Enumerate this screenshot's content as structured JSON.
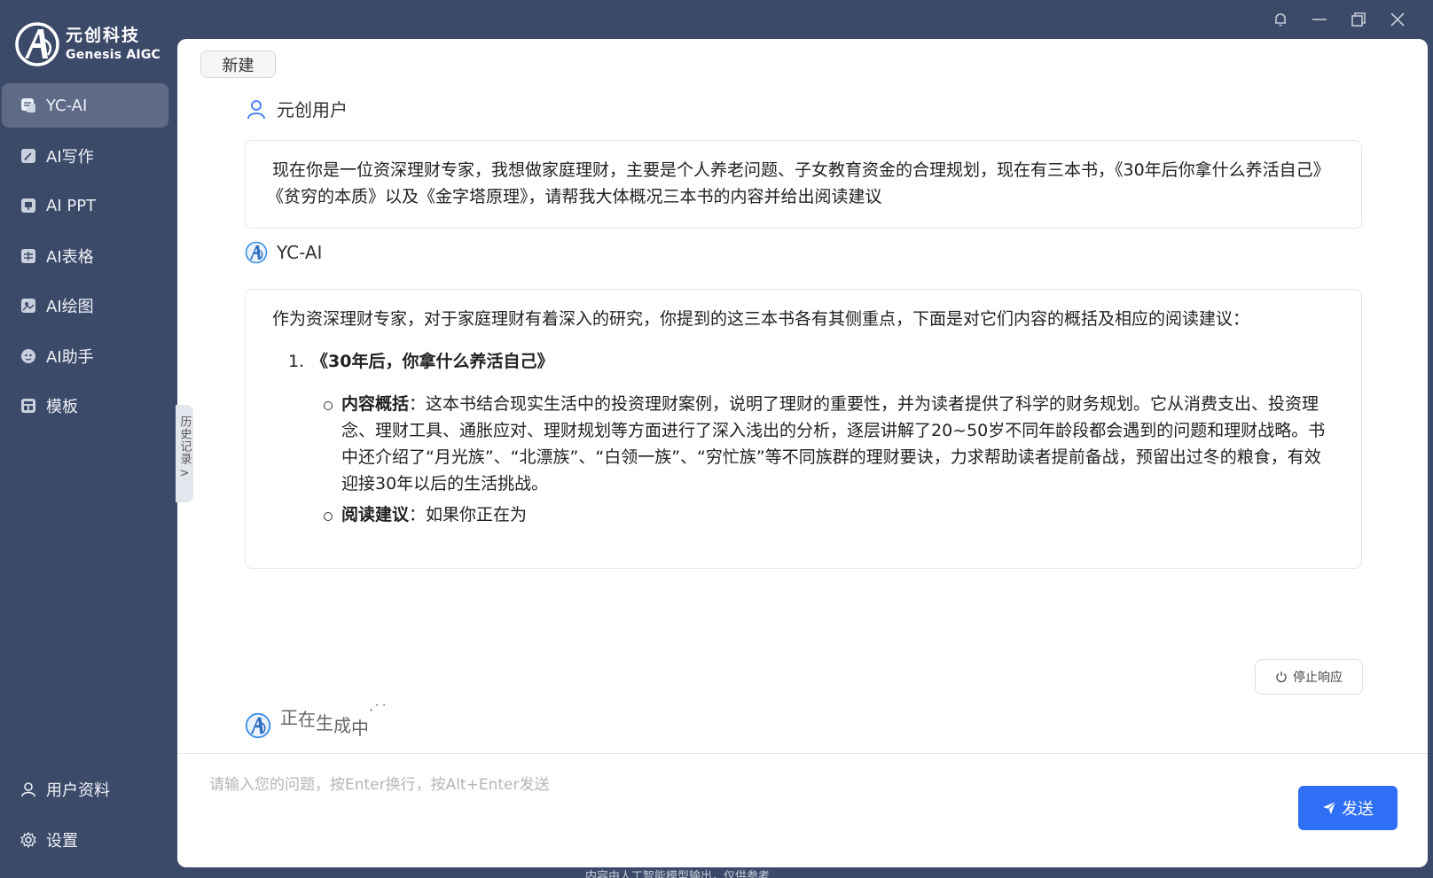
{
  "logo": {
    "cn": "元创科技",
    "en": "Genesis AIGC"
  },
  "nav": {
    "items": [
      {
        "label": "YC-AI",
        "icon": "chat-icon",
        "active": true
      },
      {
        "label": "AI写作",
        "icon": "write-icon"
      },
      {
        "label": "AI PPT",
        "icon": "ppt-icon"
      },
      {
        "label": "AI表格",
        "icon": "table-icon"
      },
      {
        "label": "AI绘图",
        "icon": "paint-icon"
      },
      {
        "label": "AI助手",
        "icon": "assistant-icon"
      },
      {
        "label": "模板",
        "icon": "template-icon"
      }
    ],
    "bottom": [
      {
        "label": "用户资料",
        "icon": "user-icon"
      },
      {
        "label": "设置",
        "icon": "gear-icon"
      }
    ]
  },
  "toolbar": {
    "new_label": "新建"
  },
  "history": {
    "label": "历史记录"
  },
  "conversation": {
    "user_name": "元创用户",
    "user_message": "现在你是一位资深理财专家，我想做家庭理财，主要是个人养老问题、子女教育资金的合理规划，现在有三本书，《30年后你拿什么养活自己》《贫穷的本质》以及《金字塔原理》，请帮我大体概况三本书的内容并给出阅读建议",
    "ai_name": "YC-AI",
    "ai_intro": "作为资深理财专家，对于家庭理财有着深入的研究，你提到的这三本书各有其侧重点，下面是对它们内容的概括及相应的阅读建议：",
    "ai_item_num": "1.",
    "ai_item_title": "《30年后，你拿什么养活自己》",
    "summary_label": "内容概括",
    "summary_text": "：这本书结合现实生活中的投资理财案例，说明了理财的重要性，并为读者提供了科学的财务规划。它从消费支出、投资理念、理财工具、通胀应对、理财规划等方面进行了深入浅出的分析，逐层讲解了20~50岁不同年龄段都会遇到的问题和理财战略。书中还介绍了“月光族”、“北漂族”、“白领一族”、“穷忙族”等不同族群的理财要诀，力求帮助读者提前备战，预留出过冬的粮食，有效迎接30年以后的生活挑战。",
    "advice_label": "阅读建议",
    "advice_text": "：如果你正在为"
  },
  "stop_label": "停止响应",
  "generating": {
    "c1": "正",
    "c2": "在",
    "c3": "生",
    "c4": "成",
    "c5": "中",
    "dots": "·˙˙"
  },
  "input": {
    "placeholder": "请输入您的问题，按Enter换行，按Alt+Enter发送"
  },
  "send_label": "发送",
  "footer": "内容由人工智能模型输出，仅供参考",
  "colors": {
    "sidebar": "#3c4a69",
    "active": "#5e6a86",
    "accent": "#2f6ff5"
  }
}
